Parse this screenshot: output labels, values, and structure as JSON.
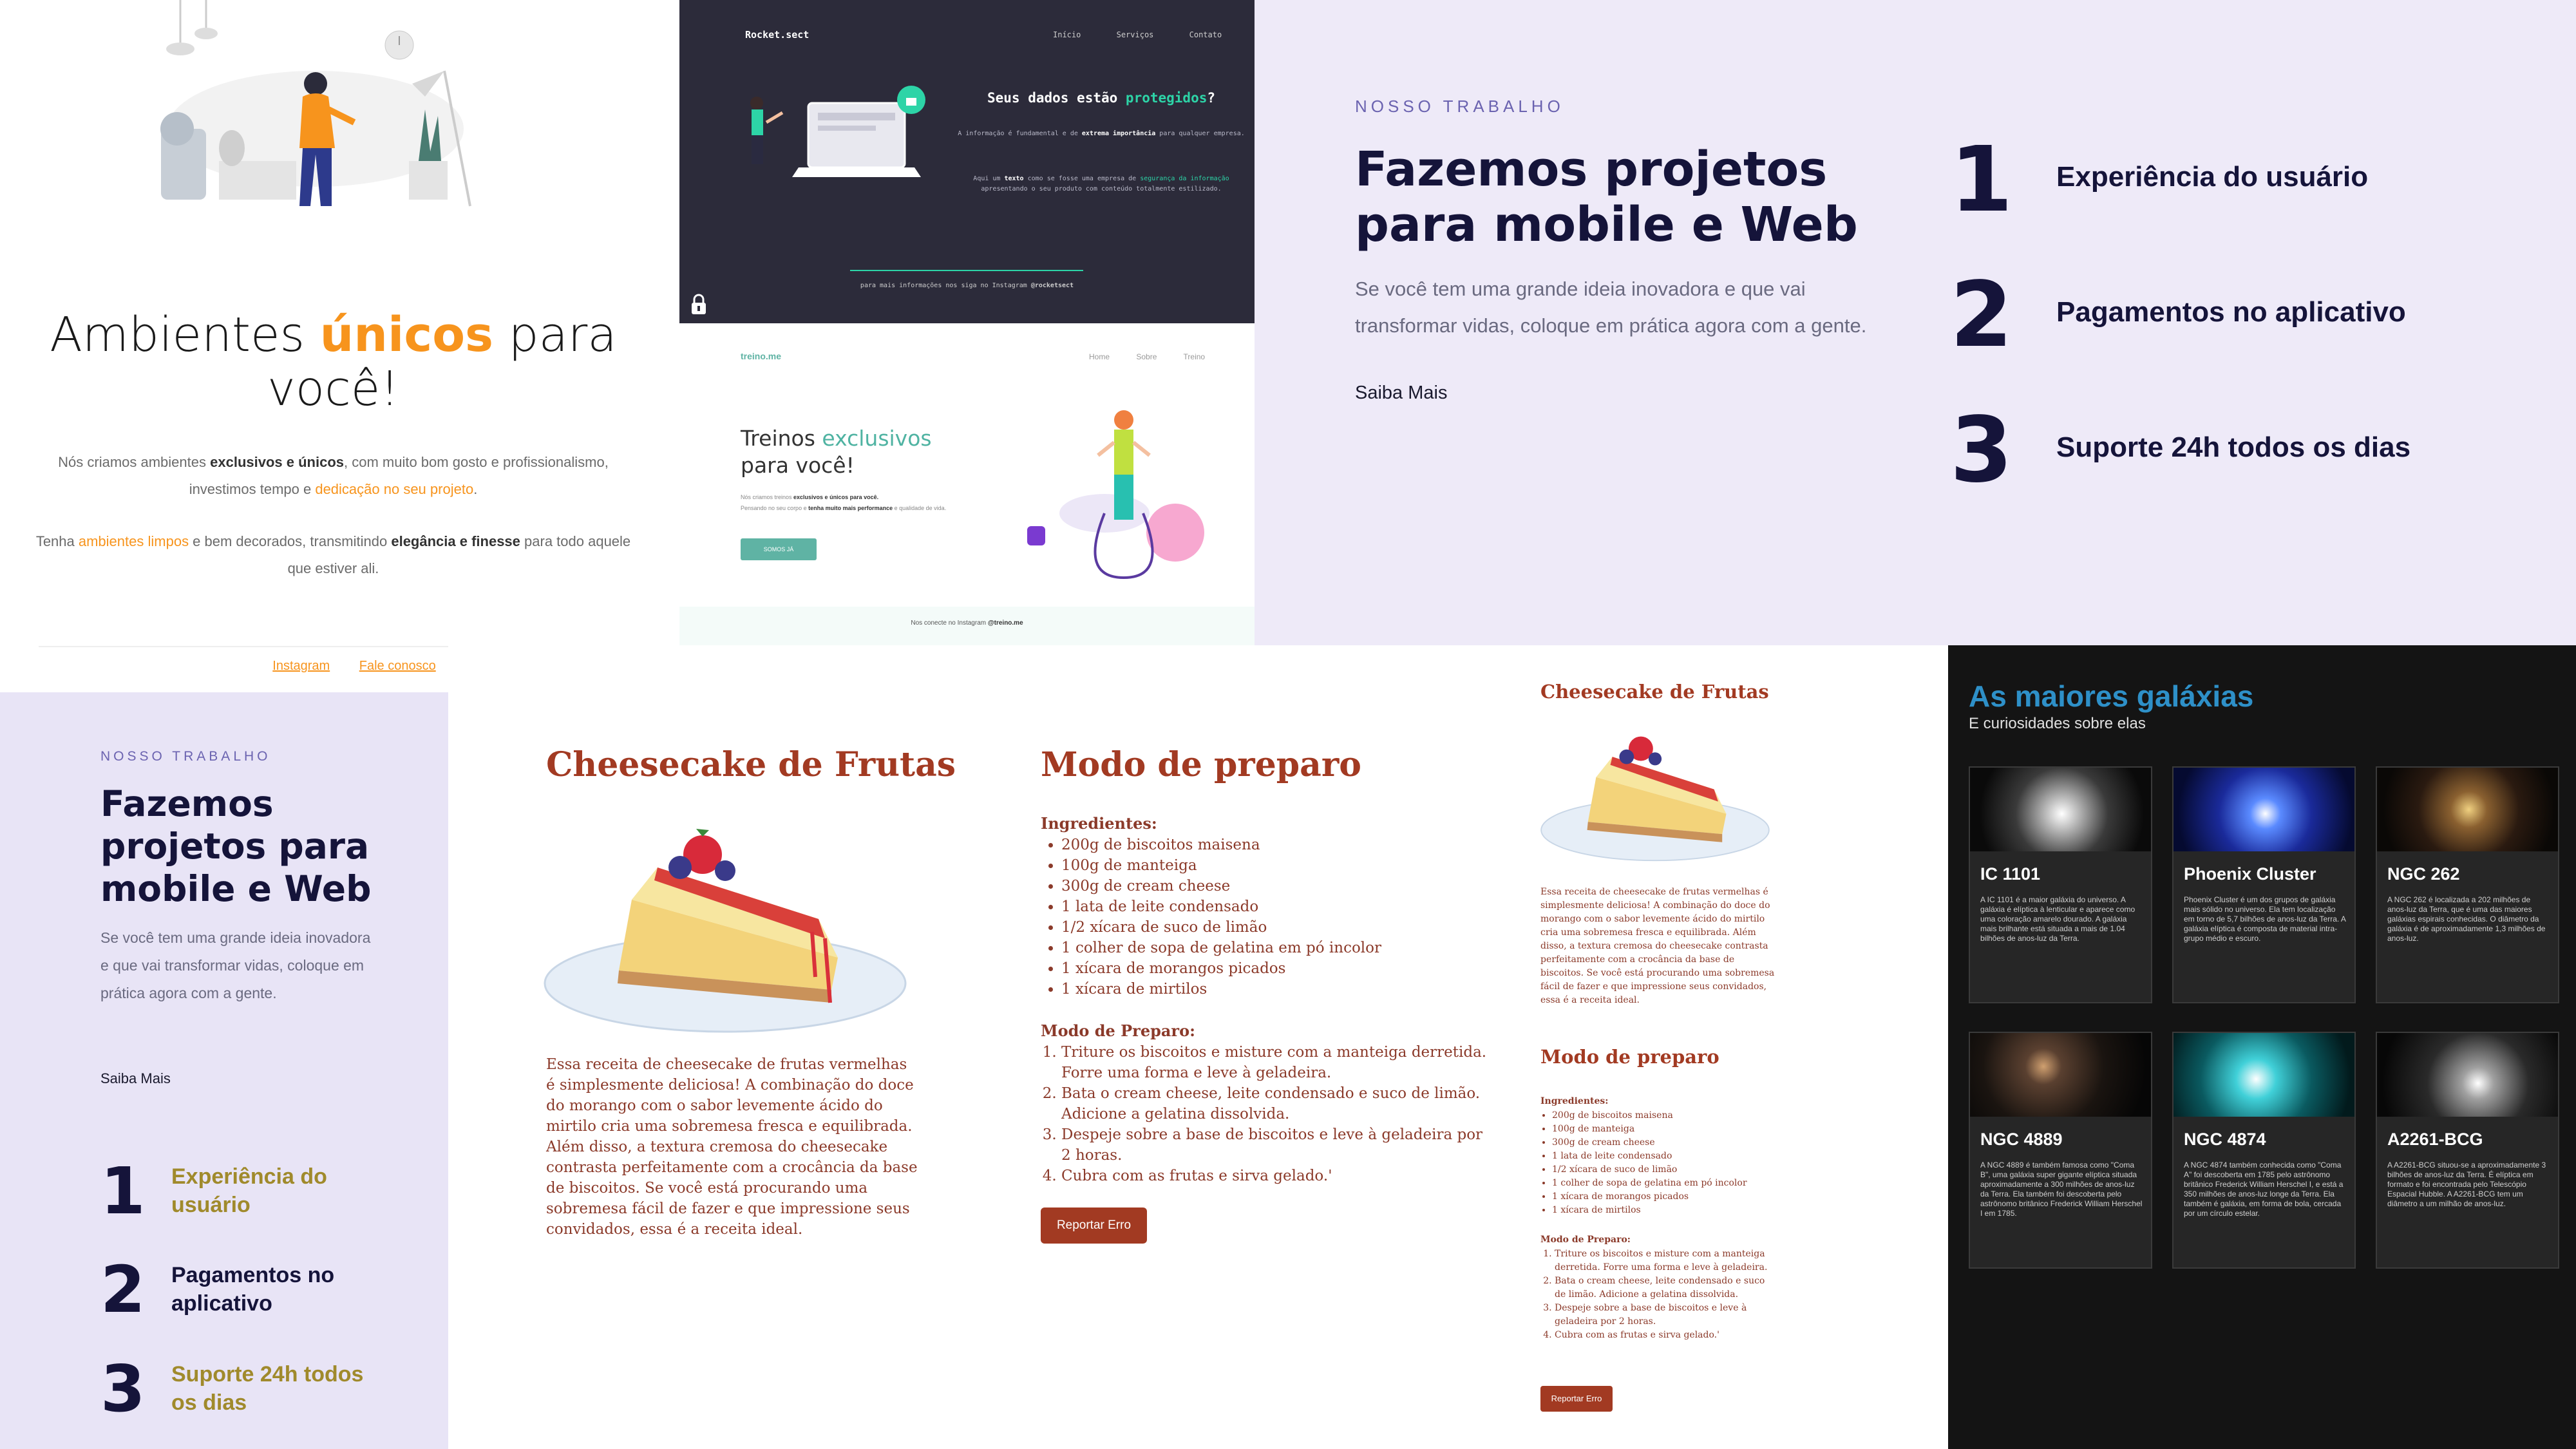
{
  "ambientes": {
    "title_pre": "Ambientes ",
    "title_highlight": "únicos",
    "title_post": " para você!",
    "p1_a": "Nós criamos ambientes ",
    "p1_b": "exclusivos e únicos",
    "p1_c": ", com muito bom gosto e profissionalismo, investimos tempo e ",
    "p1_d": "dedicação no seu projeto",
    "p1_e": ".",
    "p2_a": "Tenha ",
    "p2_b": "ambientes limpos",
    "p2_c": " e bem decorados, transmitindo ",
    "p2_d": "elegância e finesse",
    "p2_e": " para todo aquele que estiver ali.",
    "link_instagram": "Instagram",
    "link_contact": "Fale conosco",
    "accent": "#f7941d"
  },
  "rocket": {
    "logo": "Rocket.sect",
    "nav": [
      "Início",
      "Serviços",
      "Contato"
    ],
    "headline_a": "Seus dados estão ",
    "headline_b": "protegidos",
    "headline_c": "?",
    "text1_a": "A informação é fundamental e de ",
    "text1_b": "extrema importância",
    "text1_c": " para qualquer empresa.",
    "text2_a": "Aqui um ",
    "text2_b": "texto",
    "text2_c": " como se fosse uma empresa de ",
    "text2_d": "segurança da informação",
    "text2_e": " apresentando o seu produto com conteúdo totalmente estilizado.",
    "footer_a": "para mais informações nos siga no Instagram ",
    "footer_b": "@rocketsect",
    "accent": "#2dd4a7"
  },
  "treino": {
    "logo": "treino.me",
    "nav": [
      "Home",
      "Sobre",
      "Treino"
    ],
    "headline_a": "Treinos ",
    "headline_b": "exclusivos",
    "headline_c": "para você!",
    "text1_a": "Nós criamos treinos ",
    "text1_b": "exclusivos e únicos para você.",
    "text2_a": "Pensando no seu corpo e ",
    "text2_b": "tenha muito mais performance",
    "text2_c": " e qualidade de vida.",
    "button": "SOMOS JÁ",
    "footer_a": "Nos conecte no Instagram ",
    "footer_b": "@treino.me",
    "accent": "#5fb3a4"
  },
  "trabalho_large": {
    "kicker": "NOSSO TRABALHO",
    "headline": "Fazemos projetos para mobile e Web",
    "paragraph": "Se você tem uma grande ideia inovadora e que vai transformar vidas, coloque em prática agora com a gente.",
    "more": "Saiba Mais",
    "features": [
      {
        "num": "1",
        "label": "Experiência do usuário"
      },
      {
        "num": "2",
        "label": "Pagamentos no aplicativo"
      },
      {
        "num": "3",
        "label": "Suporte 24h todos os dias"
      }
    ]
  },
  "trabalho_small": {
    "kicker": "NOSSO TRABALHO",
    "headline": "Fazemos projetos para mobile e Web",
    "paragraph": "Se você tem uma grande ideia inovadora e que vai transformar vidas, coloque em prática agora com a gente.",
    "more": "Saiba Mais",
    "features": [
      {
        "num": "1",
        "label": "Experiência do usuário",
        "color": "#a08a2c"
      },
      {
        "num": "2",
        "label": "Pagamentos no aplicativo",
        "color": "#15143a"
      },
      {
        "num": "3",
        "label": "Suporte 24h todos os dias",
        "color": "#a08a2c"
      }
    ]
  },
  "cheesecake": {
    "title": "Cheesecake de Frutas",
    "description": "Essa receita de cheesecake de frutas vermelhas é simplesmente deliciosa! A combinação do doce do morango com o sabor levemente ácido do mirtilo cria uma sobremesa fresca e equilibrada. Além disso, a textura cremosa do cheesecake contrasta perfeitamente com a crocância da base de biscoitos. Se você está procurando uma sobremesa fácil de fazer e que impressione seus convidados, essa é a receita ideal.",
    "prep_title": "Modo de preparo",
    "ingredients_label": "Ingredientes:",
    "ingredients": [
      "200g de biscoitos maisena",
      "100g de manteiga",
      "300g de cream cheese",
      "1 lata de leite condensado",
      "1/2 xícara de suco de limão",
      "1 colher de sopa de gelatina em pó incolor",
      "1 xícara de morangos picados",
      "1 xícara de mirtilos"
    ],
    "steps_label": "Modo de Preparo:",
    "steps": [
      "Triture os biscoitos e misture com a manteiga derretida. Forre uma forma e leve à geladeira.",
      "Bata o cream cheese, leite condensado e suco de limão. Adicione a gelatina dissolvida.",
      "Despeje sobre a base de biscoitos e leve à geladeira por 2 horas.",
      "Cubra com as frutas e sirva gelado.'"
    ],
    "report_button": "Reportar Erro",
    "accent": "#a23a22"
  },
  "galaxias": {
    "title": "As maiores galáxias",
    "subtitle": "E curiosidades sobre elas",
    "cards": [
      {
        "name": "IC 1101",
        "text": "A IC 1101 é a maior galáxia do universo. A galáxia é elíptica à lenticular e aparece como uma coloração amarelo dourado. A galáxia mais brilhante está situada a mais de 1.04 bilhões de anos-luz da Terra.",
        "color": "#d8d8d8"
      },
      {
        "name": "Phoenix Cluster",
        "text": "Phoenix Cluster é um dos grupos de galáxia mais sólido no universo. Ela tem localização em torno de 5,7 bilhões de anos-luz da Terra. A galáxia elíptica é composta de material intra-grupo médio e escuro.",
        "color": "#2a4fd0"
      },
      {
        "name": "NGC 262",
        "text": "A NGC 262 é localizada a 202 milhões de anos-luz da Terra, que é uma das maiores galáxias espirais conhecidas. O diâmetro da galáxia é de aproximadamente 1,3 milhões de anos-luz.",
        "color": "#b08040"
      },
      {
        "name": "NGC 4889",
        "text": "A NGC 4889 é também famosa como \"Coma B\", uma galáxia super gigante elíptica situada aproximadamente a 300 milhões de anos-luz da Terra. Ela também foi descoberta pelo astrônomo britânico Frederick William Herschel I em 1785.",
        "color": "#8a6a40"
      },
      {
        "name": "NGC 4874",
        "text": "A NGC 4874 também conhecida como \"Coma A\" foi descoberta em 1785 pelo astrônomo britânico Frederick William Herschel I, e está a 350 milhões de anos-luz longe da Terra. Ela também é galáxia, em forma de bola, cercada por um círculo estelar.",
        "color": "#1aa8b0"
      },
      {
        "name": "A2261-BCG",
        "text": "A A2261-BCG situou-se a aproximadamente 3 bilhões de anos-luz da Terra. É elíptica em formato e foi encontrada pelo Telescópio Espacial Hubble. A A2261-BCG tem um diâmetro a um milhão de anos-luz.",
        "color": "#bdbdbd"
      }
    ]
  }
}
